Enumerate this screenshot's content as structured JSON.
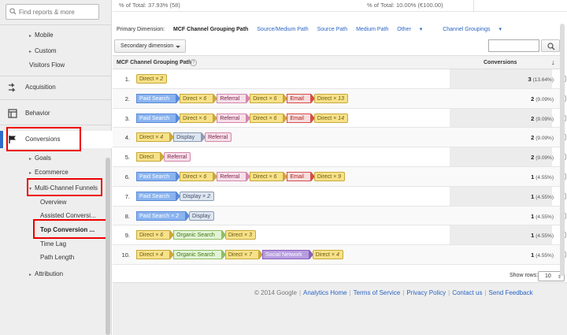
{
  "sidebar": {
    "search_placeholder": "Find reports & more",
    "items": {
      "mobile": "Mobile",
      "custom": "Custom",
      "visitors_flow": "Visitors Flow",
      "acquisition": "Acquisition",
      "behavior": "Behavior",
      "conversions": "Conversions",
      "goals": "Goals",
      "ecommerce": "Ecommerce",
      "multi_channel_funnels": "Multi-Channel Funnels",
      "overview": "Overview",
      "assisted_conversions": "Assisted Conversi...",
      "top_conversion_paths": "Top Conversion ...",
      "time_lag": "Time Lag",
      "path_length": "Path Length",
      "attribution": "Attribution"
    }
  },
  "totals": {
    "left": "% of Total: 37.93% (58)",
    "right": "% of Total: 10.00% (€100.00)"
  },
  "dimension_bar": {
    "label": "Primary Dimension:",
    "active": "MCF Channel Grouping Path",
    "links": [
      "Source/Medium Path",
      "Source Path",
      "Medium Path",
      "Other",
      "Channel Groupings"
    ]
  },
  "secondary_dimension": "Secondary dimension",
  "table": {
    "col_path": "MCF Channel Grouping Path",
    "col_conversions": "Conversions",
    "rows": [
      {
        "n": "1.",
        "chips": [
          {
            "t": "Direct",
            "m": "× 2",
            "c": "direct"
          }
        ],
        "conv": "3",
        "pct": "(13.64%)"
      },
      {
        "n": "2.",
        "chips": [
          {
            "t": "Paid Search",
            "c": "paid"
          },
          {
            "t": "Direct",
            "m": "× 6",
            "c": "direct"
          },
          {
            "t": "Referral",
            "c": "referral"
          },
          {
            "t": "Direct",
            "m": "× 6",
            "c": "direct"
          },
          {
            "t": "Email",
            "c": "email"
          },
          {
            "t": "Direct",
            "m": "× 13",
            "c": "direct"
          }
        ],
        "conv": "2",
        "pct": "(9.09%)"
      },
      {
        "n": "3.",
        "chips": [
          {
            "t": "Paid Search",
            "c": "paid"
          },
          {
            "t": "Direct",
            "m": "× 6",
            "c": "direct"
          },
          {
            "t": "Referral",
            "c": "referral"
          },
          {
            "t": "Direct",
            "m": "× 6",
            "c": "direct"
          },
          {
            "t": "Email",
            "c": "email"
          },
          {
            "t": "Direct",
            "m": "× 14",
            "c": "direct"
          }
        ],
        "conv": "2",
        "pct": "(9.09%)"
      },
      {
        "n": "4.",
        "chips": [
          {
            "t": "Direct",
            "m": "× 4",
            "c": "direct"
          },
          {
            "t": "Display",
            "c": "display"
          },
          {
            "t": "Referral",
            "c": "referral"
          }
        ],
        "conv": "2",
        "pct": "(9.09%)"
      },
      {
        "n": "5.",
        "chips": [
          {
            "t": "Direct",
            "c": "direct"
          },
          {
            "t": "Referral",
            "c": "referral"
          }
        ],
        "conv": "2",
        "pct": "(9.09%)"
      },
      {
        "n": "6.",
        "chips": [
          {
            "t": "Paid Search",
            "c": "paid"
          },
          {
            "t": "Direct",
            "m": "× 6",
            "c": "direct"
          },
          {
            "t": "Referral",
            "c": "referral"
          },
          {
            "t": "Direct",
            "m": "× 6",
            "c": "direct"
          },
          {
            "t": "Email",
            "c": "email"
          },
          {
            "t": "Direct",
            "m": "× 9",
            "c": "direct"
          }
        ],
        "conv": "1",
        "pct": "(4.55%)"
      },
      {
        "n": "7.",
        "chips": [
          {
            "t": "Paid Search",
            "c": "paid"
          },
          {
            "t": "Display",
            "m": "× 2",
            "c": "display"
          }
        ],
        "conv": "1",
        "pct": "(4.55%)"
      },
      {
        "n": "8.",
        "chips": [
          {
            "t": "Paid Search",
            "m": "× 2",
            "c": "paid"
          },
          {
            "t": "Display",
            "c": "display"
          }
        ],
        "conv": "1",
        "pct": "(4.55%)"
      },
      {
        "n": "9.",
        "chips": [
          {
            "t": "Direct",
            "m": "× 6",
            "c": "direct"
          },
          {
            "t": "Organic Search",
            "c": "organic"
          },
          {
            "t": "Direct",
            "m": "× 3",
            "c": "direct"
          }
        ],
        "conv": "1",
        "pct": "(4.55%)"
      },
      {
        "n": "10.",
        "chips": [
          {
            "t": "Direct",
            "m": "× 4",
            "c": "direct"
          },
          {
            "t": "Organic Search",
            "c": "organic"
          },
          {
            "t": "Direct",
            "m": "× 7",
            "c": "direct"
          },
          {
            "t": "Social Network",
            "c": "social"
          },
          {
            "t": "Direct",
            "m": "× 4",
            "c": "direct"
          }
        ],
        "conv": "1",
        "pct": "(4.55%)"
      }
    ]
  },
  "pagination": {
    "show_rows_label": "Show rows:",
    "show_rows_value": "10"
  },
  "footer": {
    "copyright": "© 2014 Google",
    "links": [
      "Analytics Home",
      "Terms of Service",
      "Privacy Policy",
      "Contact us",
      "Send Feedback"
    ]
  },
  "colors": {
    "accent_blue": "#2a64c5",
    "highlight_red": "#ee0000"
  },
  "icons": [
    "search-icon",
    "acquisition-icon",
    "behavior-icon",
    "conversions-flag-icon",
    "help-icon",
    "sort-down-icon",
    "caret-down-icon"
  ]
}
